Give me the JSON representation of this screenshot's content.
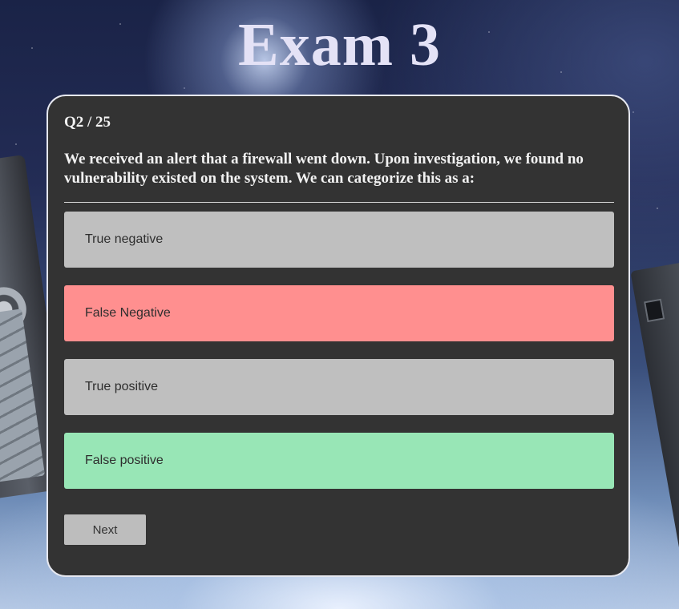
{
  "header": {
    "title": "Exam 3"
  },
  "quiz": {
    "counter": "Q2 / 25",
    "question": "We received an alert that a firewall went down. Upon investigation, we found no vulnerability existed on the system. We can categorize this as a:",
    "options": [
      {
        "label": "True negative",
        "state": "neutral",
        "color": "#bfbfbf"
      },
      {
        "label": "False Negative",
        "state": "incorrect",
        "color": "#ff8f8f"
      },
      {
        "label": "True positive",
        "state": "neutral",
        "color": "#bfbfbf"
      },
      {
        "label": "False positive",
        "state": "correct",
        "color": "#98e6b6"
      }
    ],
    "next_label": "Next"
  },
  "colors": {
    "card_background": "#333333",
    "title": "#e4e2f6"
  }
}
